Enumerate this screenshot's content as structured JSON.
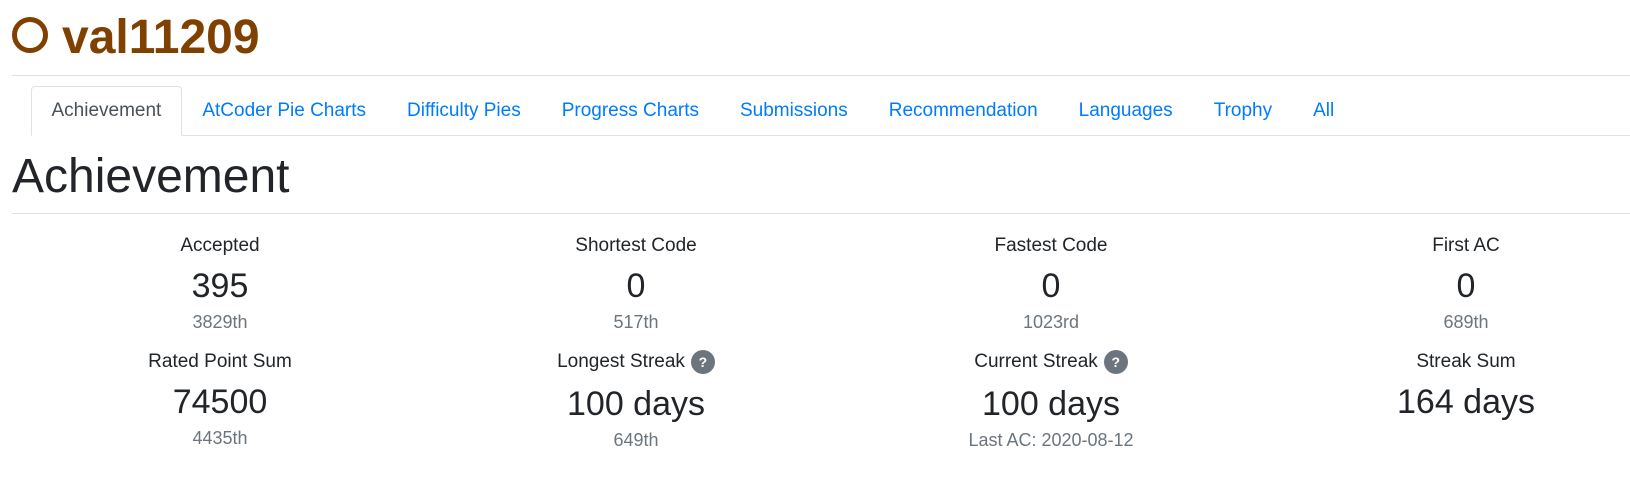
{
  "user": {
    "icon": "rating-circle-icon",
    "rating_color": "#804000",
    "name": "val11209"
  },
  "tabs": [
    {
      "label": "Achievement",
      "active": true
    },
    {
      "label": "AtCoder Pie Charts",
      "active": false
    },
    {
      "label": "Difficulty Pies",
      "active": false
    },
    {
      "label": "Progress Charts",
      "active": false
    },
    {
      "label": "Submissions",
      "active": false
    },
    {
      "label": "Recommendation",
      "active": false
    },
    {
      "label": "Languages",
      "active": false
    },
    {
      "label": "Trophy",
      "active": false
    },
    {
      "label": "All",
      "active": false
    }
  ],
  "section": {
    "title": "Achievement"
  },
  "stats": {
    "accepted": {
      "label": "Accepted",
      "value": "395",
      "sub": "3829th"
    },
    "shortest_code": {
      "label": "Shortest Code",
      "value": "0",
      "sub": "517th"
    },
    "fastest_code": {
      "label": "Fastest Code",
      "value": "0",
      "sub": "1023rd"
    },
    "first_ac": {
      "label": "First AC",
      "value": "0",
      "sub": "689th"
    },
    "rated_point_sum": {
      "label": "Rated Point Sum",
      "value": "74500",
      "sub": "4435th"
    },
    "longest_streak": {
      "label": "Longest Streak",
      "help": "?",
      "value": "100 days",
      "sub": "649th"
    },
    "current_streak": {
      "label": "Current Streak",
      "help": "?",
      "value": "100 days",
      "sub": "Last AC: 2020-08-12"
    },
    "streak_sum": {
      "label": "Streak Sum",
      "value": "164 days"
    }
  },
  "colors": {
    "link": "#007bff",
    "muted": "#6c757d",
    "text": "#212529"
  }
}
